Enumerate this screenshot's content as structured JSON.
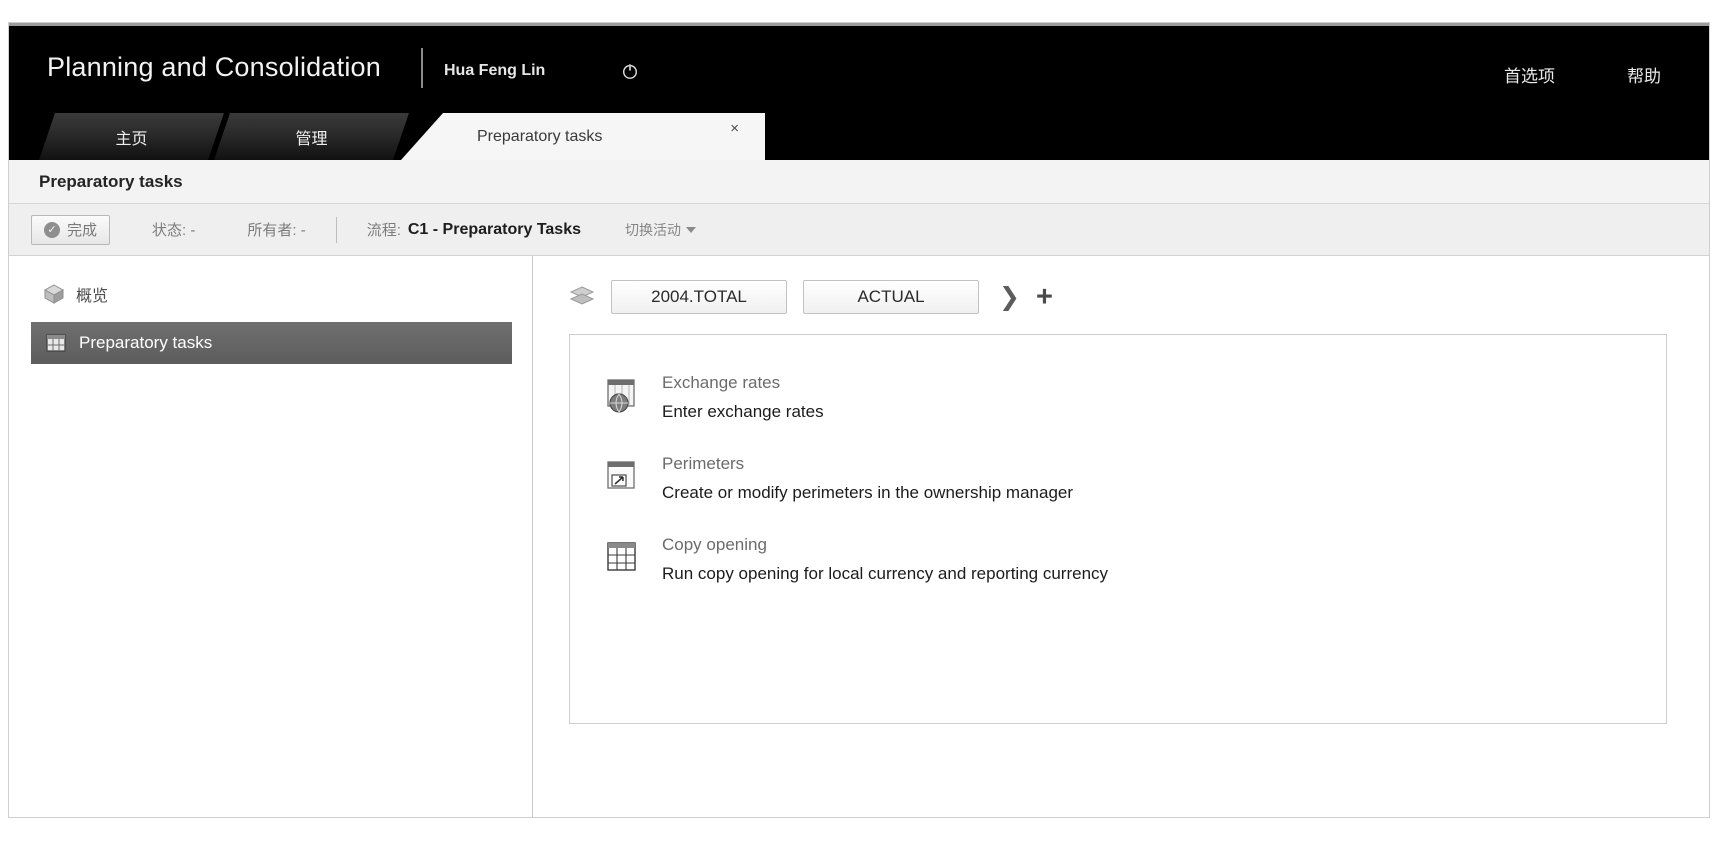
{
  "header": {
    "brand": "Planning and Consolidation",
    "user": "Hua Feng Lin",
    "logout_icon": "power-icon",
    "links": [
      {
        "label": "首选项",
        "name": "preferences"
      },
      {
        "label": "帮助",
        "name": "help"
      }
    ]
  },
  "tabs": [
    {
      "label": "主页",
      "active": false
    },
    {
      "label": "管理",
      "active": false
    },
    {
      "label": "Preparatory tasks",
      "active": true,
      "close": "×"
    }
  ],
  "page": {
    "title": "Preparatory tasks"
  },
  "toolbar": {
    "done_label": "完成",
    "done_icon": "check-circle-icon",
    "status_label": "状态:",
    "status_value": "-",
    "owner_label": "所有者:",
    "owner_value": "-",
    "process_label": "流程:",
    "process_value": "C1 - Preparatory Tasks",
    "switch_activity_label": "切换活动"
  },
  "sidebar": {
    "overview_label": "概览",
    "overview_icon": "cube-icon",
    "items": [
      {
        "label": "Preparatory tasks",
        "icon": "grid-icon",
        "selected": true
      }
    ]
  },
  "context": {
    "icon": "stack-icon",
    "buttons": [
      {
        "label": "2004.TOTAL"
      },
      {
        "label": "ACTUAL"
      }
    ],
    "chevron": "❯",
    "add_label": "+"
  },
  "tasks": [
    {
      "title": "Exchange rates",
      "desc": "Enter exchange rates",
      "icon": "globe-sheet-icon"
    },
    {
      "title": "Perimeters",
      "desc": "Create or modify perimeters in the ownership manager",
      "icon": "window-arrow-icon"
    },
    {
      "title": "Copy opening",
      "desc": "Run copy opening for local currency and reporting currency",
      "icon": "table-grid-icon"
    }
  ],
  "colors": {
    "header_bg": "#000000",
    "selected_item_bg": "#646464",
    "page_bg": "#ffffff"
  }
}
